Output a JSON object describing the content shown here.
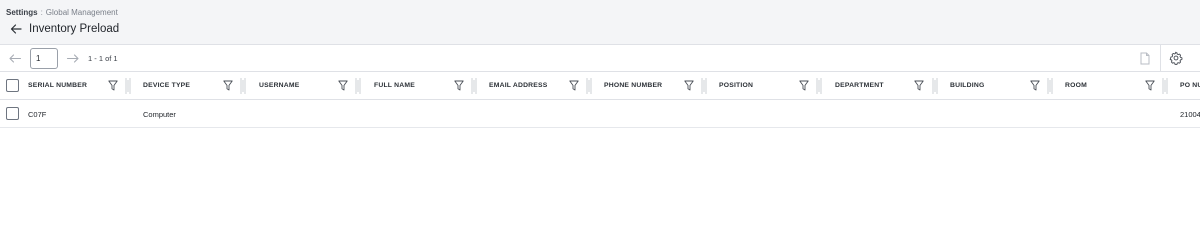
{
  "breadcrumb": {
    "root": "Settings",
    "separator": ":",
    "leaf": "Global Management"
  },
  "page": {
    "title": "Inventory Preload"
  },
  "pagination": {
    "current_page": "1",
    "range_label": "1 - 1 of 1"
  },
  "table": {
    "columns": [
      {
        "key": "serial_number",
        "label": "SERIAL NUMBER"
      },
      {
        "key": "device_type",
        "label": "DEVICE TYPE"
      },
      {
        "key": "username",
        "label": "USERNAME"
      },
      {
        "key": "full_name",
        "label": "FULL NAME"
      },
      {
        "key": "email_address",
        "label": "EMAIL ADDRESS"
      },
      {
        "key": "phone_number",
        "label": "PHONE NUMBER"
      },
      {
        "key": "position",
        "label": "POSITION"
      },
      {
        "key": "department",
        "label": "DEPARTMENT"
      },
      {
        "key": "building",
        "label": "BUILDING"
      },
      {
        "key": "room",
        "label": "ROOM"
      },
      {
        "key": "po_number",
        "label": "PO NU"
      }
    ],
    "rows": [
      {
        "serial_number": "C07F",
        "device_type": "Computer",
        "po_number": "21004"
      }
    ]
  },
  "icons": {
    "back": "arrow-left-icon",
    "prev": "arrow-left-icon",
    "next": "arrow-right-icon",
    "export": "document-icon",
    "settings": "gear-icon",
    "filter": "filter-icon",
    "resize": "column-resize-icon"
  },
  "colors": {
    "header_bg": "#f4f5f7",
    "border": "#dfe1e6",
    "text": "#1f2329",
    "muted": "#8a8f98"
  }
}
